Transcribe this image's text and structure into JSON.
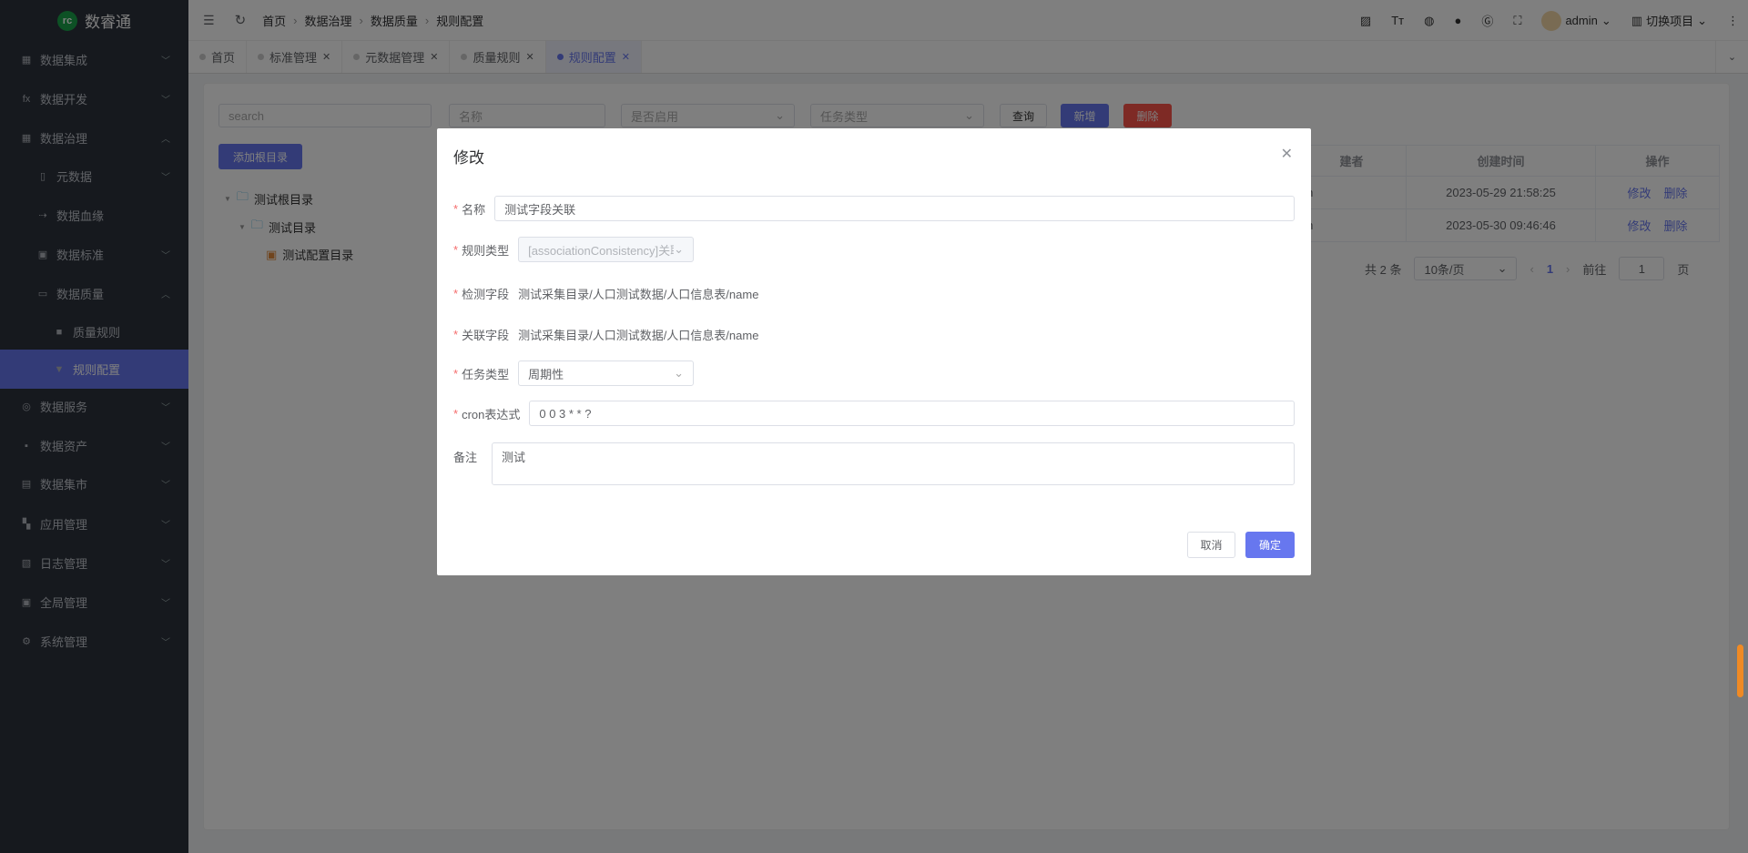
{
  "app": {
    "name": "数睿通",
    "logo_text": "rc"
  },
  "sidebar": {
    "items": [
      {
        "label": "数据集成",
        "icon": "grid-icon",
        "level": 1,
        "expanded": false
      },
      {
        "label": "数据开发",
        "icon": "fx-icon",
        "level": 1,
        "expanded": false
      },
      {
        "label": "数据治理",
        "icon": "table-icon",
        "level": 1,
        "expanded": true
      },
      {
        "label": "元数据",
        "icon": "file-icon",
        "level": 2,
        "expanded": false
      },
      {
        "label": "数据血缘",
        "icon": "lineage-icon",
        "level": 2
      },
      {
        "label": "数据标准",
        "icon": "standard-icon",
        "level": 2,
        "expanded": false
      },
      {
        "label": "数据质量",
        "icon": "card-icon",
        "level": 2,
        "expanded": true
      },
      {
        "label": "质量规则",
        "icon": "lock-icon",
        "level": 3
      },
      {
        "label": "规则配置",
        "icon": "brush-icon",
        "level": 3,
        "active": true
      },
      {
        "label": "数据服务",
        "icon": "service-icon",
        "level": 1,
        "expanded": false
      },
      {
        "label": "数据资产",
        "icon": "terminal-icon",
        "level": 1,
        "expanded": false
      },
      {
        "label": "数据集市",
        "icon": "market-icon",
        "level": 1,
        "expanded": false
      },
      {
        "label": "应用管理",
        "icon": "apps-icon",
        "level": 1,
        "expanded": false
      },
      {
        "label": "日志管理",
        "icon": "log-icon",
        "level": 1,
        "expanded": false
      },
      {
        "label": "全局管理",
        "icon": "wallet-icon",
        "level": 1,
        "expanded": false
      },
      {
        "label": "系统管理",
        "icon": "gear-icon",
        "level": 1,
        "expanded": false
      }
    ]
  },
  "header": {
    "breadcrumb": [
      "首页",
      "数据治理",
      "数据质量",
      "规则配置"
    ],
    "user": "admin",
    "switch_project": "切换项目"
  },
  "tabs": [
    {
      "label": "首页",
      "closable": false
    },
    {
      "label": "标准管理",
      "closable": true
    },
    {
      "label": "元数据管理",
      "closable": true
    },
    {
      "label": "质量规则",
      "closable": true
    },
    {
      "label": "规则配置",
      "closable": true,
      "active": true
    }
  ],
  "toolbar": {
    "search_placeholder": "search",
    "name_placeholder": "名称",
    "enabled_placeholder": "是否启用",
    "task_type_placeholder": "任务类型",
    "query": "查询",
    "add": "新增",
    "delete": "删除",
    "add_root": "添加根目录"
  },
  "tree": [
    {
      "label": "测试根目录",
      "depth": 0
    },
    {
      "label": "测试目录",
      "depth": 1
    },
    {
      "label": "测试配置目录",
      "depth": 2
    }
  ],
  "table": {
    "headers": [
      "建者",
      "创建时间",
      "操作"
    ],
    "rows": [
      {
        "creator": "nin",
        "created": "2023-05-29 21:58:25",
        "edit": "修改",
        "delete": "删除"
      },
      {
        "creator": "nin",
        "created": "2023-05-30 09:46:46",
        "edit": "修改",
        "delete": "删除"
      }
    ]
  },
  "pagination": {
    "total": "共 2 条",
    "page_size": "10条/页",
    "current": "1",
    "goto_label": "前往",
    "goto_value": "1",
    "page_suffix": "页"
  },
  "modal": {
    "title": "修改",
    "name_label": "名称",
    "name_value": "测试字段关联",
    "rule_type_label": "规则类型",
    "rule_type_value": "[associationConsistency]关联",
    "check_field_label": "检测字段",
    "check_field_value": "测试采集目录/人口测试数据/人口信息表/name",
    "assoc_field_label": "关联字段",
    "assoc_field_value": "测试采集目录/人口测试数据/人口信息表/name",
    "task_type_label": "任务类型",
    "task_type_value": "周期性",
    "cron_label": "cron表达式",
    "cron_value": "0 0 3 * * ?",
    "remark_label": "备注",
    "remark_value": "测试",
    "cancel": "取消",
    "confirm": "确定"
  },
  "colors": {
    "accent": "#6777ef",
    "danger": "#fc544b",
    "sidebar": "#2c323c"
  }
}
